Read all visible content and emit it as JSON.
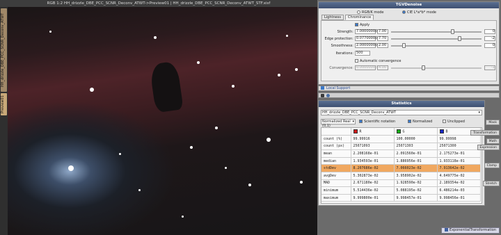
{
  "image_window": {
    "title": "RGB 1:2  HH_drizzle_DBE_PCC_SCNR_Deconv_ATWT->Preview01 | HH_drizzle_DBE_PCC_SCNR_Deconv_ATWT_STF.xisf",
    "side_tab_main": "HH_drizzle_DBE_PCC_SCNR_Deconv_ATWT",
    "side_tab_preview": "Preview01"
  },
  "tgv": {
    "title": "TGVDenoise",
    "mode_rgbk": "RGB/K mode",
    "mode_ciel": "CIE L*a*b* mode",
    "tab_lightness": "Lightness",
    "tab_chrominance": "Chrominance",
    "apply_label": "Apply",
    "strength_label": "Strength:",
    "strength_value": "7.00000000",
    "strength_exp": "7.00",
    "strength_right": "0",
    "edge_label": "Edge protection:",
    "edge_value": "0.07700000",
    "edge_exp": "7.70",
    "edge_right": "-2",
    "smooth_label": "Smoothness:",
    "smooth_value": "2.00000000",
    "smooth_exp": "2.00",
    "smooth_right": "0",
    "iter_label": "Iterations:",
    "iter_value": "500",
    "auto_conv_label": "Automatic convergence",
    "conv_label": "Convergence:",
    "conv_value": "0.00000000",
    "conv_exp": "4.00",
    "conv_right": "-1",
    "local_support": "Local Support"
  },
  "stats": {
    "title": "Statistics",
    "view_select": "HH_drizzle_DBE_PCC_SCNR_Deconv_ATWT",
    "range_select": "Normalized Real (0,1)",
    "sci_notation": "Scientific notation",
    "normalized": "Normalized",
    "unclipped": "Unclipped",
    "columns": [
      "R",
      "G",
      "B"
    ],
    "rows": [
      {
        "label": "count (%)",
        "r": "99.99916",
        "g": "100.00000",
        "b": "99.99998"
      },
      {
        "label": "count (px)",
        "r": "25071093",
        "g": "25071303",
        "b": "25071300"
      },
      {
        "label": "mean",
        "r": "2.208168e-01",
        "g": "2.091560e-01",
        "b": "2.175273e-01"
      },
      {
        "label": "median",
        "r": "1.934593e-01",
        "g": "1.886956e-01",
        "b": "1.933118e-01"
      },
      {
        "label": "stdDev",
        "r": "8.207686e-02",
        "g": "7.066023e-02",
        "b": "7.913642e-02"
      },
      {
        "label": "avgDev",
        "r": "5.302873e-02",
        "g": "3.958902e-02",
        "b": "4.649775e-02"
      },
      {
        "label": "MAD",
        "r": "2.671180e-02",
        "g": "1.928590e-02",
        "b": "2.189354e-02"
      },
      {
        "label": "minimum",
        "r": "5.514436e-02",
        "g": "5.088195e-02",
        "b": "6.486214e-03"
      },
      {
        "label": "maximum",
        "r": "9.999800e-01",
        "g": "9.998457e-01",
        "b": "9.998456e-01"
      }
    ],
    "highlight_row": 4,
    "colors": {
      "r": "#d01818",
      "g": "#18b018",
      "b": "#1828c8",
      "highlight": "#f0a860"
    }
  },
  "side_buttons": [
    "Mask",
    "Transformation",
    "Math",
    "Expression",
    "Clamp",
    "Stretch"
  ],
  "taskbar_item": "ExponentialTransformation"
}
